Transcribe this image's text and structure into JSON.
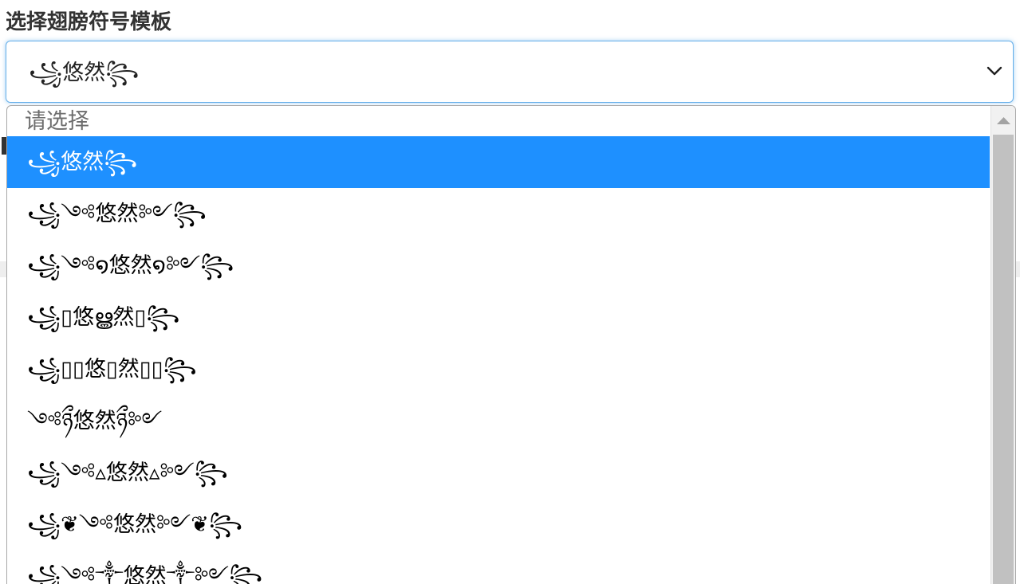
{
  "field": {
    "label": "选择翅膀符号模板",
    "selected_value": "꧁悠然꧂"
  },
  "dropdown": {
    "options": [
      {
        "label": "请选择",
        "placeholder": true
      },
      {
        "label": "꧁悠然꧂",
        "selected": true
      },
      {
        "label": "꧁༺悠然༻꧂"
      },
      {
        "label": "꧁༺໑悠然໑༻꧂"
      },
      {
        "label": "꧁▯悠ൠ然▯꧂"
      },
      {
        "label": "꧁▯▯悠▯然▯▯꧂"
      },
      {
        "label": "༺ཉྀ悠然ཉྀ༻"
      },
      {
        "label": "꧁༺▵悠然▵༻꧂"
      },
      {
        "label": "꧁❦༺悠然༻❦꧂"
      },
      {
        "label": "꧁༺༒悠然༒༻꧂"
      }
    ]
  },
  "icons": {
    "select_toggle": "chevron-down-icon",
    "scroll_up": "triangle-up-icon"
  },
  "colors": {
    "highlight": "#1e90ff",
    "focus_border": "#66afe9",
    "scroll_thumb": "#c1c1c1"
  }
}
